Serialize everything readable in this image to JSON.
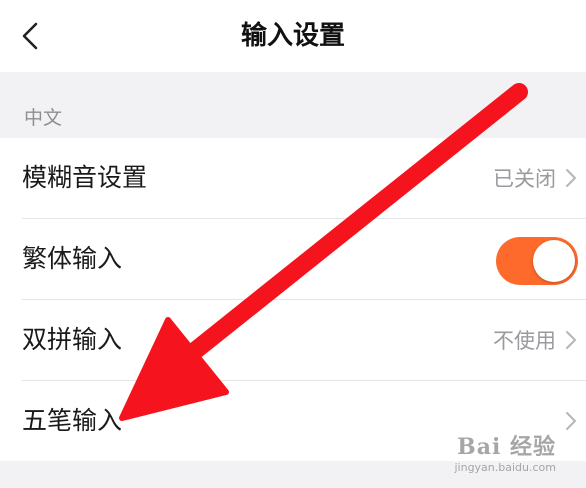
{
  "nav": {
    "title": "输入设置",
    "back_icon": "chevron-left-icon"
  },
  "section": {
    "header": "中文"
  },
  "rows": [
    {
      "label": "模糊音设置",
      "value": "已关闭",
      "control": "chevron"
    },
    {
      "label": "繁体输入",
      "control": "toggle",
      "toggle_on": true
    },
    {
      "label": "双拼输入",
      "value": "不使用",
      "control": "chevron"
    },
    {
      "label": "五笔输入",
      "control": "chevron"
    }
  ],
  "annotation": {
    "type": "arrow",
    "color": "#f5141e"
  },
  "watermark": {
    "main": "Bai 经验",
    "sub": "jingyan.baidu.com"
  },
  "colors": {
    "toggle_on": "#fd6a2c",
    "background": "#f2f2f4"
  }
}
